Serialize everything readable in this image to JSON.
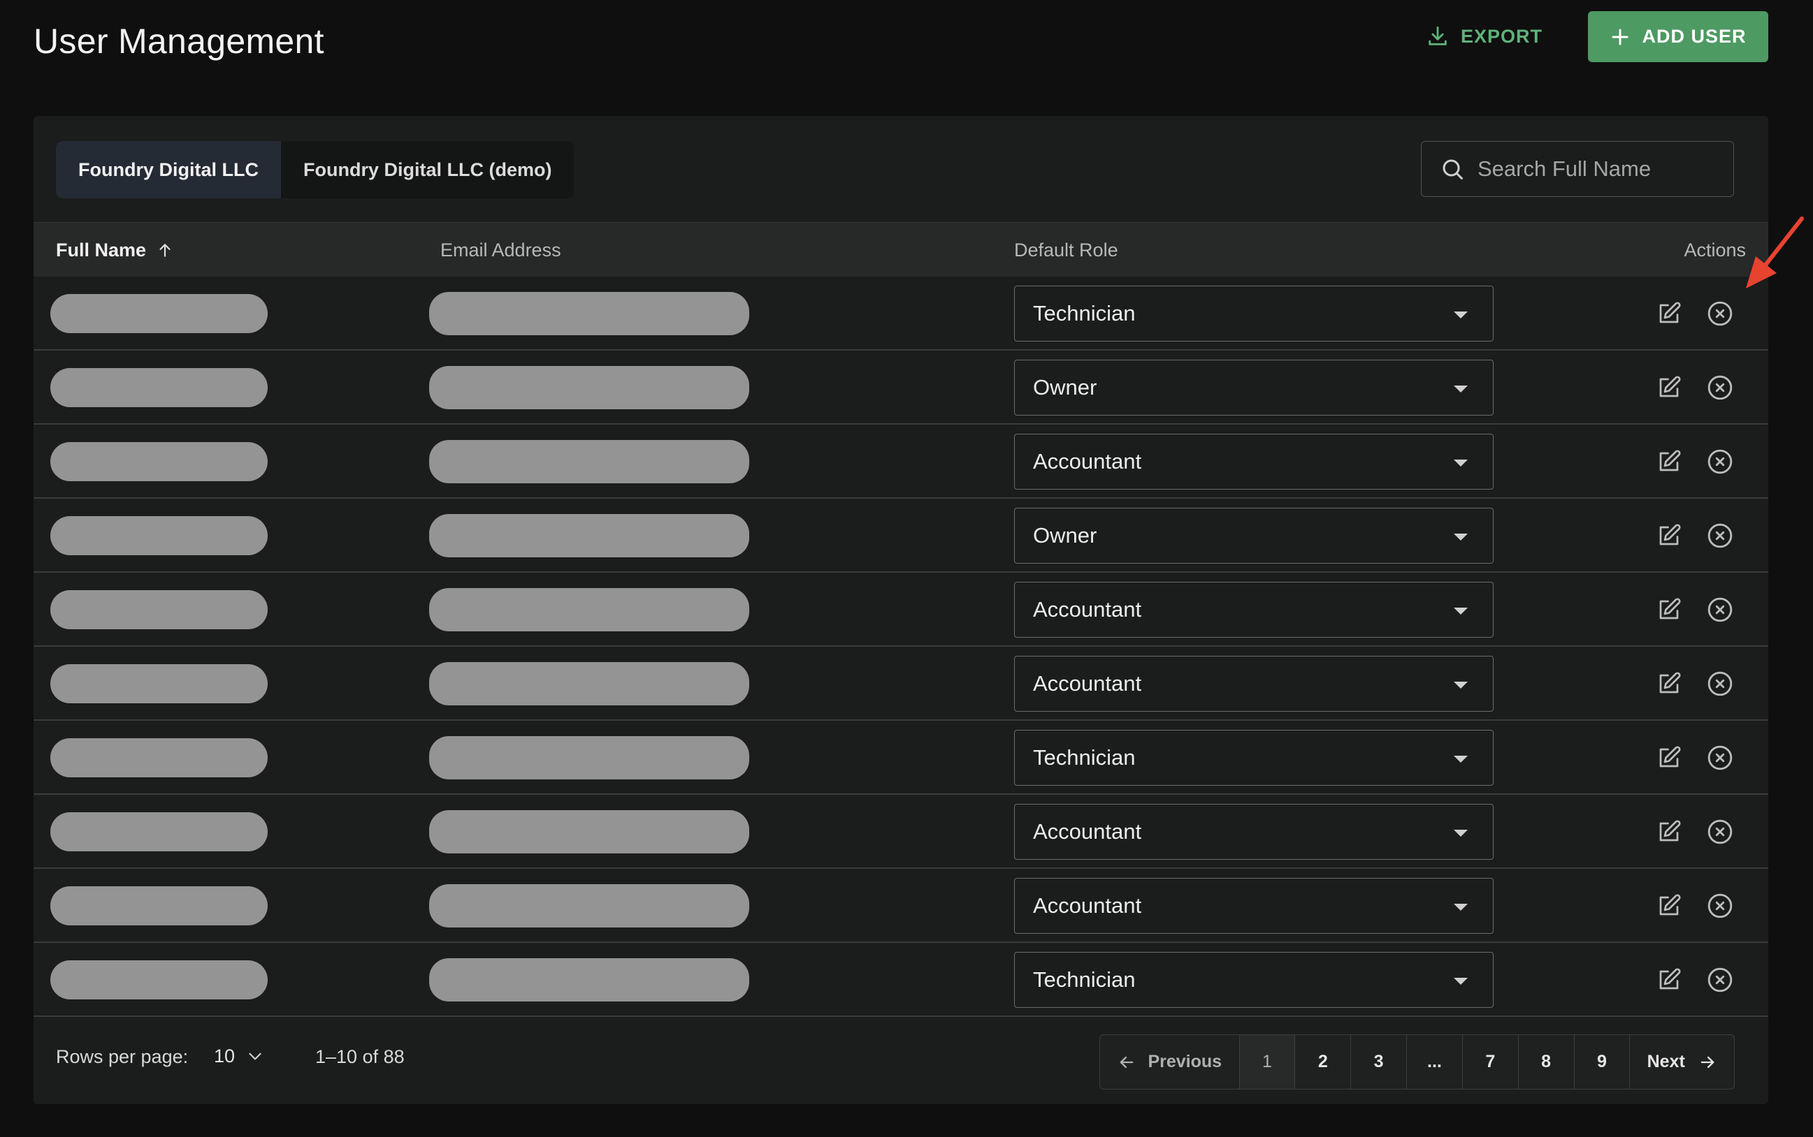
{
  "header": {
    "title": "User Management",
    "export_label": "EXPORT",
    "add_user_label": "ADD USER"
  },
  "tabs": [
    {
      "label": "Foundry Digital LLC",
      "active": true
    },
    {
      "label": "Foundry Digital LLC (demo)",
      "active": false
    }
  ],
  "search": {
    "placeholder": "Search Full Name",
    "value": ""
  },
  "table": {
    "columns": {
      "name": "Full Name",
      "email": "Email Address",
      "role": "Default Role",
      "actions": "Actions"
    },
    "rows": [
      {
        "role": "Technician"
      },
      {
        "role": "Owner"
      },
      {
        "role": "Accountant"
      },
      {
        "role": "Owner"
      },
      {
        "role": "Accountant"
      },
      {
        "role": "Accountant"
      },
      {
        "role": "Technician"
      },
      {
        "role": "Accountant"
      },
      {
        "role": "Accountant"
      },
      {
        "role": "Technician"
      }
    ]
  },
  "footer": {
    "rows_per_page_label": "Rows per page:",
    "rows_per_page_value": "10",
    "range_text": "1–10 of 88",
    "pagination": {
      "previous": "Previous",
      "next": "Next",
      "pages": [
        "1",
        "2",
        "3",
        "...",
        "7",
        "8",
        "9"
      ],
      "current": "1"
    }
  },
  "colors": {
    "accent_green": "#4e9a63",
    "export_green": "#5fb27a",
    "annotation_arrow": "#e8432f"
  }
}
